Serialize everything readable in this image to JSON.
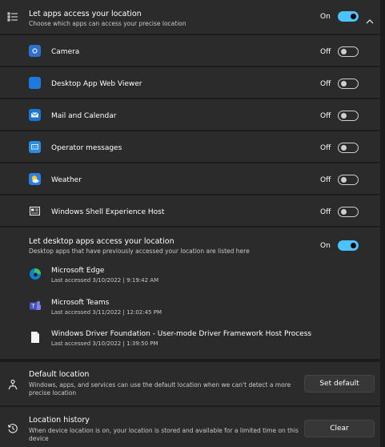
{
  "main": {
    "title": "Let apps access your location",
    "subtitle": "Choose which apps can access your precise location",
    "state": "On",
    "toggle_on": true
  },
  "apps": [
    {
      "name": "Camera",
      "state": "Off",
      "icon": "camera-icon",
      "color": "#2f6fd0"
    },
    {
      "name": "Desktop App Web Viewer",
      "state": "Off",
      "icon": "web-viewer-icon",
      "color": "#1f7ae0"
    },
    {
      "name": "Mail and Calendar",
      "state": "Off",
      "icon": "mail-icon",
      "color": "#1976d2"
    },
    {
      "name": "Operator messages",
      "state": "Off",
      "icon": "operator-messages-icon",
      "color": "#2b8de0"
    },
    {
      "name": "Weather",
      "state": "Off",
      "icon": "weather-icon",
      "color": "#2a7fe0"
    },
    {
      "name": "Windows Shell Experience Host",
      "state": "Off",
      "icon": "shell-host-icon",
      "color": "#f0f0f0"
    }
  ],
  "desktop": {
    "title": "Let desktop apps access your location",
    "subtitle": "Desktop apps that have previously accessed your location are listed here",
    "state": "On",
    "toggle_on": true,
    "apps": [
      {
        "name": "Microsoft Edge",
        "accessed": "Last accessed 3/10/2022  |  9:19:42 AM",
        "icon": "edge-icon"
      },
      {
        "name": "Microsoft Teams",
        "accessed": "Last accessed 3/11/2022  |  12:02:45 PM",
        "icon": "teams-icon"
      },
      {
        "name": "Windows Driver Foundation - User-mode Driver Framework Host Process",
        "accessed": "Last accessed 3/10/2022  |  1:39:50 PM",
        "icon": "file-icon"
      }
    ]
  },
  "default_location": {
    "title": "Default location",
    "subtitle_line1": "Windows, apps, and services can use the default location when we can't detect a more",
    "subtitle_line2": "precise location",
    "button": "Set default"
  },
  "history": {
    "title": "Location history",
    "subtitle_line1": "When device location is on, your location is stored and available for a limited time on this",
    "subtitle_line2": "device",
    "button": "Clear"
  },
  "colors": {
    "accent": "#4cc2ff",
    "card": "#2b2b2b",
    "background": "#1c1c1c"
  }
}
